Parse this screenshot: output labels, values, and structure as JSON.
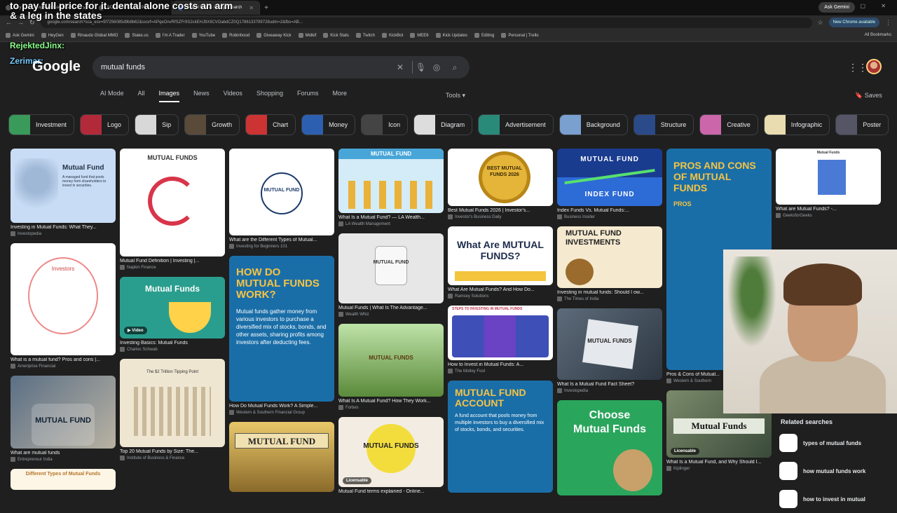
{
  "browser": {
    "tabs": [
      {
        "label": "to pay full price for it. dental alone costs an arm"
      },
      {
        "label": "Day 1 — Complete Finance an..."
      },
      {
        "label": "SOL $194.67 +0.09% | ..."
      },
      {
        "label": "mutual funds - Google Search",
        "active": true
      }
    ],
    "ask_gemini": "Ask Gemini",
    "url": "google.com/search?sca_esv=5f7256085d9b8b62&sxsrf=APqeOnvRfSZFr9S2ckEHJ9XIlCVOabdCZ0Q1786133799728udm=2&fbs=AB...",
    "new_chrome": "New Chrome available",
    "bookmarks": [
      "Ask Gemini",
      "HeyGen",
      "Rinaudo Global MMO",
      "Stake.us",
      "I'm A Trader",
      "YouTube",
      "Robinhood",
      "Giveaway Kick",
      "Midkif",
      "Kick Stats",
      "Twitch",
      "KickBot",
      "MEE6",
      "Kick Updates",
      "Editing",
      "Personal | Trello"
    ],
    "all_bookmarks": "All Bookmarks"
  },
  "overlay": {
    "line1": "to pay full price for it. dental alone costs an arm",
    "line2": "& a leg in the states",
    "user1": "RejektedJinx:",
    "user2": "Zerimar:"
  },
  "google": {
    "logo": "Google",
    "query": "mutual funds",
    "tabs": [
      "AI Mode",
      "All",
      "Images",
      "News",
      "Videos",
      "Shopping",
      "Forums",
      "More"
    ],
    "active_tab": "Images",
    "tools": "Tools",
    "saves": "Saves",
    "chips": [
      "Investment",
      "Logo",
      "Sip",
      "Growth",
      "Chart",
      "Money",
      "Icon",
      "Diagram",
      "Advertisement",
      "Background",
      "Structure",
      "Creative",
      "Infographic",
      "Poster"
    ]
  },
  "results": {
    "col1": [
      {
        "img_text": "Mutual Fund",
        "sub": "A managed fund that pools money from shareholders to invest in securities.",
        "caption": "Investing in Mutual Funds: What They...",
        "source": "Investopedia"
      },
      {
        "img_text": "Investors",
        "caption": "What is a mutual fund? Pros and cons |...",
        "source": "Ameriprise Financial"
      },
      {
        "img_text": "MUTUAL FUND",
        "caption": "What are mutual funds",
        "source": "Entrepreneur India"
      },
      {
        "img_text": "Different Types of Mutual Funds"
      }
    ],
    "col2": [
      {
        "img_text": "MUTUAL FUNDS",
        "caption": "Mutual Fund Definition | Investing |...",
        "source": "Napkin Finance"
      },
      {
        "img_text": "Mutual Funds",
        "badge": "Video",
        "caption": "Investing Basics: Mutual Funds",
        "source": "Charles Schwab"
      },
      {
        "img_text": "The $2 Trillion Tipping Point",
        "caption": "Top 20 Mutual Funds by Size: The...",
        "source": "Institute of Business & Finance"
      }
    ],
    "col3": [
      {
        "img_text": "MUTUAL FUND",
        "caption": "What are the Different Types of Mutual...",
        "source": "Investing for Beginners 101"
      },
      {
        "img_text": "HOW DO MUTUAL FUNDS WORK?",
        "sub": "Mutual funds gather money from various investors to purchase a diversified mix of stocks, bonds, and other assets, sharing profits among investors after deducting fees.",
        "caption": "How Do Mutual Funds Work? A Simple...",
        "source": "Western & Southern Financial Group"
      },
      {
        "img_text": "MUTUAL FUND"
      }
    ],
    "col4": [
      {
        "img_text": "MUTUAL FUND",
        "caption": "What Is a Mutual Fund? — LA Wealth...",
        "source": "LA Wealth Management"
      },
      {
        "img_text": "MUTUAL FUND",
        "caption": "Mutual Funds | What Is The Advantage...",
        "source": "Wealth Whiz"
      },
      {
        "img_text": "MUTUAL FUNDS",
        "caption": "What Is A Mutual Fund? How They Work...",
        "source": "Forbes"
      },
      {
        "img_text": "MUTUAL FUNDS",
        "badge": "Licensable",
        "caption": "Mutual Fund terms explained - Online..."
      }
    ],
    "col5": [
      {
        "img_text": "BEST MUTUAL FUNDS 2026",
        "caption": "Best Mutual Funds 2026 | Investor's...",
        "source": "Investor's Business Daily"
      },
      {
        "img_text": "What Are MUTUAL FUNDS?",
        "caption": "What Are Mutual Funds? And How Do...",
        "source": "Ramsey Solutions"
      },
      {
        "img_text": "STEPS TO INVESTING IN MUTUAL FUNDS",
        "caption": "How to Invest in Mutual Funds: A...",
        "source": "The Motley Fool"
      },
      {
        "img_text": "MUTUAL FUND ACCOUNT",
        "sub": "A fund account that pools money from multiple investors to buy a diversified mix of stocks, bonds, and securities."
      }
    ],
    "col6": [
      {
        "img_text": "MUTUAL FUND",
        "sub": "INDEX FUND",
        "caption": "Index Funds Vs. Mutual Funds:...",
        "source": "Business Insider"
      },
      {
        "img_text": "MUTUAL FUND INVESTMENTS",
        "caption": "Investing in mutual funds: Should I ow...",
        "source": "The Times of India"
      },
      {
        "img_text": "MUTUAL FUNDS",
        "caption": "What Is a Mutual Fund Fact Sheet?",
        "source": "Investopedia"
      },
      {
        "img_text": "Choose Mutual Funds"
      }
    ],
    "col7": [
      {
        "img_text": "PROS AND CONS OF MUTUAL FUNDS",
        "sub": "PROS",
        "caption": "Pros & Cons of Mutual...",
        "source": "Western & Southern"
      },
      {
        "img_text": "Mutual Funds",
        "badge": "Licensable",
        "caption": "What Is a Mutual Fund, and Why Should I...",
        "source": "Kiplinger"
      }
    ],
    "col8": [
      {
        "img_text": "Mutual Funds",
        "caption": "What are Mutual Funds? -...",
        "source": "GeeksforGeeks"
      }
    ]
  },
  "related": {
    "title": "Related searches",
    "items": [
      "types of mutual funds",
      "how mutual funds work",
      "how to invest in mutual"
    ]
  }
}
